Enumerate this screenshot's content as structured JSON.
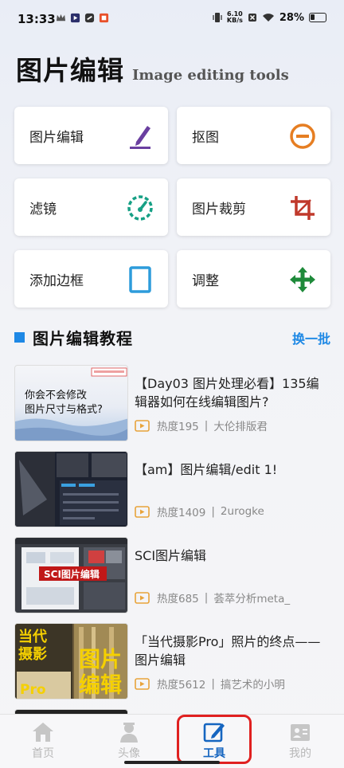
{
  "status": {
    "time": "13:33",
    "net_speed_value": "6.10",
    "net_speed_unit": "KB/s",
    "battery": "28%"
  },
  "header": {
    "title": "图片编辑",
    "subtitle": "Image editing tools"
  },
  "tools": [
    {
      "label": "图片编辑",
      "icon": "pen-icon",
      "color": "#6a3fa0"
    },
    {
      "label": "抠图",
      "icon": "minus-circle-icon",
      "color": "#e67e22"
    },
    {
      "label": "滤镜",
      "icon": "gauge-icon",
      "color": "#16a085"
    },
    {
      "label": "图片裁剪",
      "icon": "crop-icon",
      "color": "#c0392b"
    },
    {
      "label": "添加边框",
      "icon": "frame-icon",
      "color": "#2d9cdb"
    },
    {
      "label": "调整",
      "icon": "move-arrows-icon",
      "color": "#1e8a3a"
    }
  ],
  "section": {
    "title": "图片编辑教程",
    "refresh": "换一批"
  },
  "tutorials": [
    {
      "title": "【Day03 图片处理必看】135编辑器如何在线编辑图片?",
      "heat": "热度195",
      "author": "大伦排版君",
      "thumb_text": "你会不会修改\n图片尺寸与格式?"
    },
    {
      "title": "【am】图片编辑/edit 1!",
      "heat": "热度1409",
      "author": "2urogke",
      "thumb_text": ""
    },
    {
      "title": "SCI图片编辑",
      "heat": "热度685",
      "author": "荟萃分析meta_",
      "thumb_text": "SCI图片编辑"
    },
    {
      "title": "「当代摄影Pro」照片的终点——图片编辑",
      "heat": "热度5612",
      "author": "搞艺术的小明",
      "thumb_text": "当代摄影Pro图片编辑"
    }
  ],
  "nav": [
    {
      "label": "首页",
      "icon": "home-icon"
    },
    {
      "label": "头像",
      "icon": "avatar-icon"
    },
    {
      "label": "工具",
      "icon": "edit-tool-icon"
    },
    {
      "label": "我的",
      "icon": "profile-card-icon"
    }
  ],
  "colors": {
    "accent": "#1e88e5",
    "active_nav": "#1565c0",
    "highlight_ring": "#e02020"
  }
}
